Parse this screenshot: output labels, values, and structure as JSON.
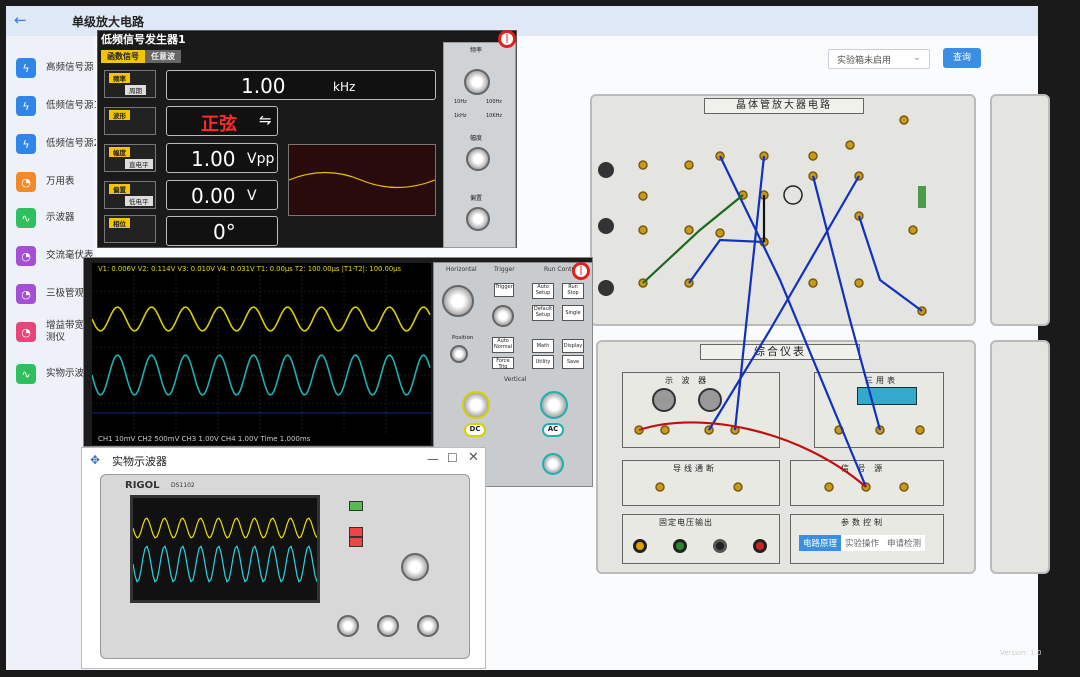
{
  "header": {
    "back_icon": "arrow-left-icon",
    "title": "单级放大电路"
  },
  "sidebar": {
    "items": [
      {
        "label": "高频信号源",
        "icon": "lightning-icon",
        "color": "#2f86e8"
      },
      {
        "label": "低频信号源1",
        "icon": "lightning-icon",
        "color": "#2f86e8"
      },
      {
        "label": "低频信号源2",
        "icon": "lightning-icon",
        "color": "#2f86e8"
      },
      {
        "label": "万用表",
        "icon": "gauge-icon",
        "color": "#f08a2a"
      },
      {
        "label": "示波器",
        "icon": "wave-icon",
        "color": "#2fbf5f"
      },
      {
        "label": "交流毫伏表",
        "icon": "gauge-icon",
        "color": "#a44fd6"
      },
      {
        "label": "三极管观测",
        "icon": "gauge-icon",
        "color": "#a44fd6"
      },
      {
        "label": "增益带宽积测仪",
        "icon": "gauge-icon",
        "color": "#e8457a"
      },
      {
        "label": "实物示波器",
        "icon": "wave-icon",
        "color": "#2fbf5f"
      }
    ]
  },
  "toolbar": {
    "select_value": "实验箱未启用",
    "query_label": "查询"
  },
  "right_icons": [
    "save-icon",
    "upload-icon",
    "camera-icon",
    "book-icon",
    "document-icon",
    "help-icon"
  ],
  "generator": {
    "title": "低频信号发生器1",
    "tabs": [
      "函数信号",
      "任意波"
    ],
    "keys": [
      {
        "main": "频率",
        "sub": "周期"
      },
      {
        "main": "波形",
        "sub": ""
      },
      {
        "main": "幅度",
        "sub": "直电平"
      },
      {
        "main": "偏置",
        "sub": "低电平"
      },
      {
        "main": "相位",
        "sub": ""
      }
    ],
    "freq_value": "1.00",
    "freq_unit": "kHz",
    "wave_value": "正弦",
    "wave_switch": "⇋",
    "amp_value": "1.00",
    "amp_unit": "Vpp",
    "offset_value": "0.00",
    "offset_unit": "V",
    "phase_value": "0°",
    "knob_labels": [
      "频率",
      "幅度",
      "偏置"
    ],
    "range_labels": [
      "10Hz",
      "100Hz",
      "1kHz",
      "10KHz"
    ]
  },
  "scope": {
    "header": "V1: 0.006V V2: 0.114V V3: 0.010V V4: 0.031V T1: 0.00μs   T2: 100.00μs |T1-T2|: 100.00μs",
    "footer": "CH1  10mV  CH2  500mV  CH3  1.00V  CH4  1.00V      Time  1.000ms",
    "section_labels": [
      "Horizontal",
      "Trigger",
      "Run Control",
      "Vertical"
    ],
    "buttons": [
      "Trigger",
      "Auto Setup",
      "Run Stop",
      "Default Setup",
      "Single",
      "Auto Normal",
      "Force Trig",
      "Math",
      "Display",
      "Utility",
      "Save"
    ],
    "position_label": "Position",
    "coupling": [
      "DC",
      "AC"
    ]
  },
  "physical_scope": {
    "title": "实物示波器",
    "brand": "RIGOL",
    "model": "DS1102"
  },
  "board1": {
    "title": "晶体管放大器电路"
  },
  "board2": {
    "title": "综合仪表",
    "sections": [
      "示 波 器",
      "三用表",
      "导线通断",
      "信 号 源",
      "固定电压输出",
      "参数控制"
    ],
    "tabs": [
      "电路原理",
      "实验操作",
      "申请检测"
    ]
  },
  "version": "Version: 1.0"
}
